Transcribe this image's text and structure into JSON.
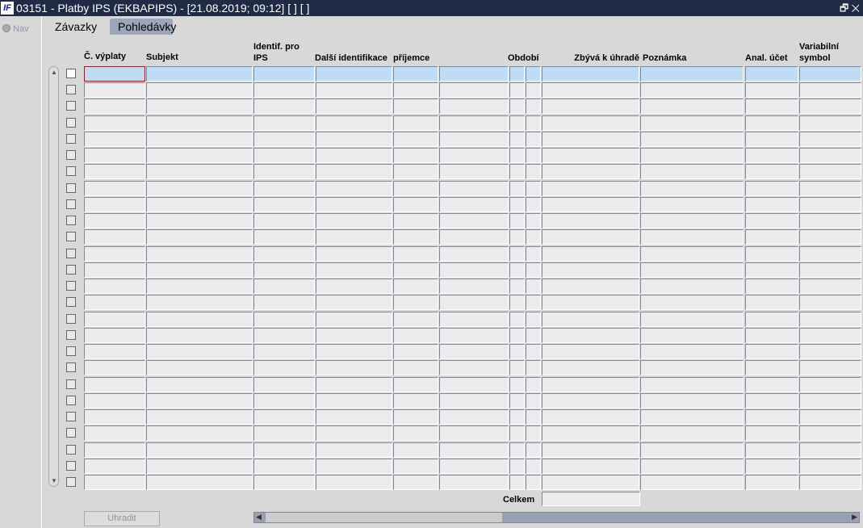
{
  "window": {
    "title": "03151 - Platby IPS (EKBAPIPS) - [21.08.2019; 09:12]  [ ]  [ ]",
    "logo": "IF",
    "controls": "🗗 ✕"
  },
  "nav": {
    "label": "Nav"
  },
  "tabs": [
    {
      "label": "Závazky",
      "active": true
    },
    {
      "label": "Pohledávky",
      "active": false
    }
  ],
  "columns": [
    {
      "label": "Č. výplaty"
    },
    {
      "label": "Subjekt"
    },
    {
      "label": "Identif. pro IPS"
    },
    {
      "label": "Další identifikace"
    },
    {
      "label": "příjemce"
    },
    {
      "label": ""
    },
    {
      "label": "Období"
    },
    {
      "label": ""
    },
    {
      "label": "Zbývá k úhradě"
    },
    {
      "label": "Poznámka"
    },
    {
      "label": "Anal. účet"
    },
    {
      "label": "Variabilní symbol"
    }
  ],
  "row_count": 26,
  "footer": {
    "total_label": "Celkem",
    "total_value": "",
    "pay_button": "Uhradit"
  }
}
